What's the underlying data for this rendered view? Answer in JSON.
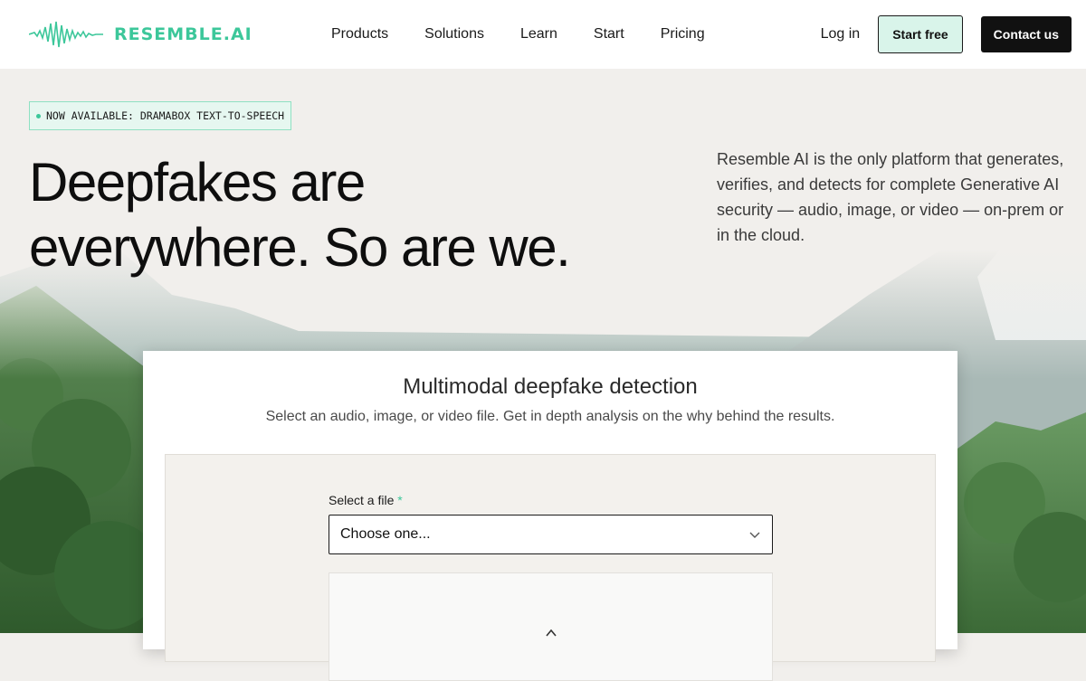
{
  "header": {
    "brand": "RESEMBLE.AI",
    "nav": [
      "Products",
      "Solutions",
      "Learn",
      "Start",
      "Pricing"
    ],
    "login": "Log in",
    "start_free": "Start free",
    "contact": "Contact us"
  },
  "hero": {
    "badge": "NOW AVAILABLE: DRAMABOX TEXT-TO-SPEECH",
    "headline_line1": "Deepfakes are",
    "headline_line2": "everywhere. So are we.",
    "description": "Resemble AI is the only platform that generates, verifies, and detects for complete Generative AI security — audio, image, or video — on-prem or in the cloud."
  },
  "detector": {
    "title": "Multimodal deepfake detection",
    "subtitle": "Select an audio, image, or video file. Get in depth analysis on the why behind the results.",
    "field_label": "Select a file",
    "required_mark": "*",
    "select_value": "Choose one..."
  },
  "colors": {
    "accent": "#3cc79a",
    "badge_bg": "#e6f7f0",
    "start_btn_bg": "#d9f4ea",
    "page_bg": "#f1efec"
  },
  "icons": [
    "waveform-logo-icon",
    "chevron-down-icon",
    "upload-icon",
    "badge-dot-icon"
  ]
}
